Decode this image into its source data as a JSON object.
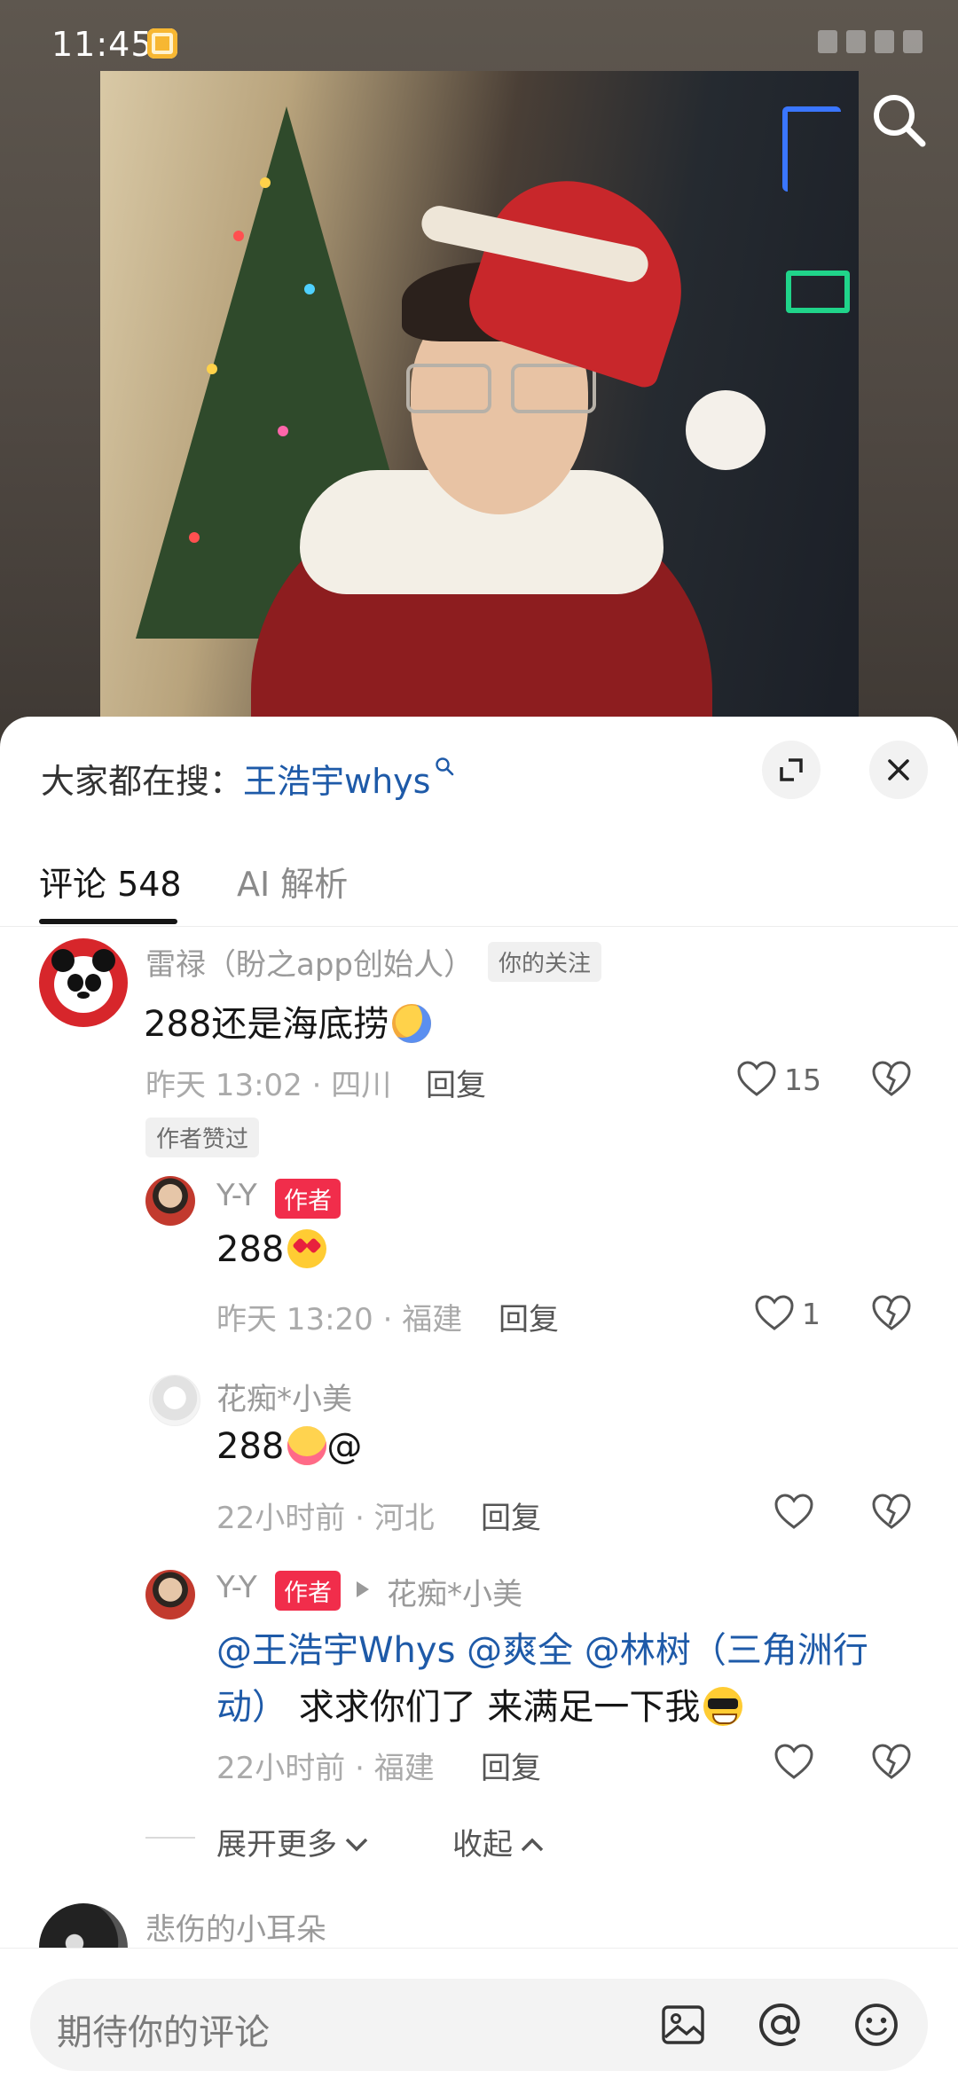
{
  "status": {
    "time": "11:45"
  },
  "sheet": {
    "hot_search_prefix": "大家都在搜：",
    "hot_search_keyword": "王浩宇whys"
  },
  "tabs": {
    "comments": "评论 548",
    "ai": "AI 解析"
  },
  "comments": [
    {
      "user": "雷禄（盼之app创始人）",
      "badge": "你的关注",
      "text": "288还是海底捞",
      "emoji": "hugging-face",
      "time": "昨天 13:02",
      "location": "四川",
      "reply": "回复",
      "likes": "15",
      "author_liked": "作者赞过",
      "replies": [
        {
          "user": "Y-Y",
          "author_tag": "作者",
          "text": "288",
          "emoji": "heart-eyes",
          "time": "昨天 13:20",
          "location": "福建",
          "reply": "回复",
          "likes": "1"
        },
        {
          "user": "花痴*小美",
          "text": "288",
          "text_suffix": "@",
          "emoji": "pleading-face",
          "time": "22小时前",
          "location": "河北",
          "reply": "回复",
          "likes": ""
        },
        {
          "user": "Y-Y",
          "author_tag": "作者",
          "reply_to": "花痴*小美",
          "mentions_line1": "@王浩宇Whys @爽全 @林树（三角洲行",
          "mentions_line2_mention": "动）",
          "text_line2": " 求求你们了  来满足一下我",
          "emoji": "sunglasses-face",
          "time": "22小时前",
          "location": "福建",
          "reply": "回复",
          "likes": ""
        }
      ],
      "expand_more": "展开更多",
      "collapse": "收起"
    },
    {
      "user": "悲伤的小耳朵"
    }
  ],
  "input": {
    "placeholder": "期待你的评论"
  },
  "colors": {
    "mention": "#1e5aa8",
    "author_tag": "#f12d4b"
  },
  "icons": [
    "search-icon",
    "expand-icon",
    "close-icon",
    "heart-icon",
    "broken-heart-icon",
    "image-icon",
    "at-icon",
    "emoji-icon",
    "play-arrow-icon",
    "chevron-down-icon",
    "chevron-up-icon"
  ]
}
